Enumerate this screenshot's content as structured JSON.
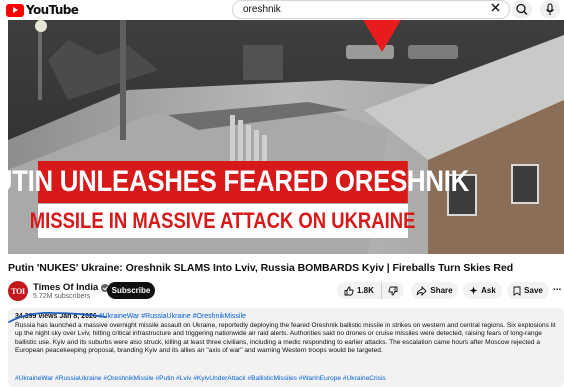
{
  "header": {
    "logo_text": "YouTube",
    "search_value": "oreshnik",
    "clear_icon": "close-icon",
    "search_icon": "search-icon",
    "mic_icon": "mic-icon"
  },
  "video": {
    "banner_line1": "PUTIN UNLEASHES FEARED ORESHNIK",
    "banner_line2": "MISSILE IN MASSIVE ATTACK ON UKRAINE",
    "banner_colors": {
      "red": "#d7191a",
      "white": "#ffffff"
    }
  },
  "title": "Putin 'NUKES' Ukraine: Oreshnik SLAMS Into Lviv, Russia BOMBARDS Kyiv | Fireballs Turn Skies Red",
  "channel": {
    "avatar_text": "TOI",
    "name": "Times Of India",
    "subscribers": "5.72M subscribers",
    "subscribe_label": "Subscribe"
  },
  "actions": {
    "likes": "1.8K",
    "share_label": "Share",
    "ask_label": "Ask",
    "save_label": "Save",
    "more_label": "..."
  },
  "description": {
    "views": "34,399 views",
    "date": "Jan 8, 2026",
    "hashtags_inline": "#UkraineWar #RussiaUkraine #OreshnikMissile",
    "text": "Russia has launched a massive overnight missile assault on Ukraine, reportedly deploying the feared Oreshnik ballistic missile in strikes on western and central regions. Six explosions lit up the night sky over Lviv, hitting critical infrastructure and triggering nationwide air raid alerts. Authorities said no drones or cruise missiles were detected, raising fears of long-range ballistic use. Kyiv and its suburbs were also struck, killing at least three civilians, including a medic responding to earlier attacks. The escalation came hours after Moscow rejected a European peacekeeping proposal, branding Kyiv and its allies an \"axis of war\" and warning Western troops would be targeted.",
    "hashtags_bottom": "#UkraineWar #RussiaUkraine #OreshnikMissile #Putin #Lviv #KyivUnderAttack #BallisticMissiles #WarInEurope #UkraineCrisis"
  },
  "colors": {
    "brand_red": "#ff0000",
    "link_blue": "#065fd4",
    "button_bg": "#f2f2f2",
    "subscribe_bg": "#0f0f0f"
  }
}
